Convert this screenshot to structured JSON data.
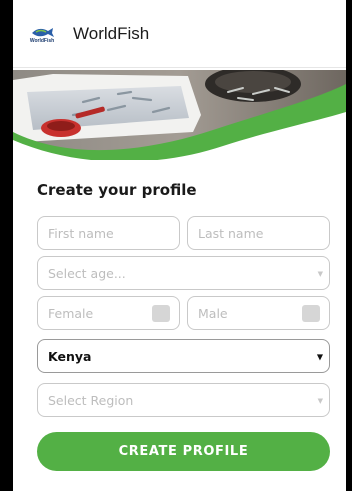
{
  "header": {
    "logo_text": "WorldFish",
    "app_title": "WorldFish"
  },
  "form": {
    "title": "Create your profile",
    "first_name_placeholder": "First name",
    "last_name_placeholder": "Last name",
    "age_placeholder": "Select age...",
    "female_label": "Female",
    "male_label": "Male",
    "country_value": "Kenya",
    "region_placeholder": "Select Region",
    "submit_label": "CREATE PROFILE"
  },
  "icons": {
    "chevron": "▼"
  },
  "colors": {
    "accent_green": "#53b045",
    "brand_blue": "#1b3b6e"
  }
}
